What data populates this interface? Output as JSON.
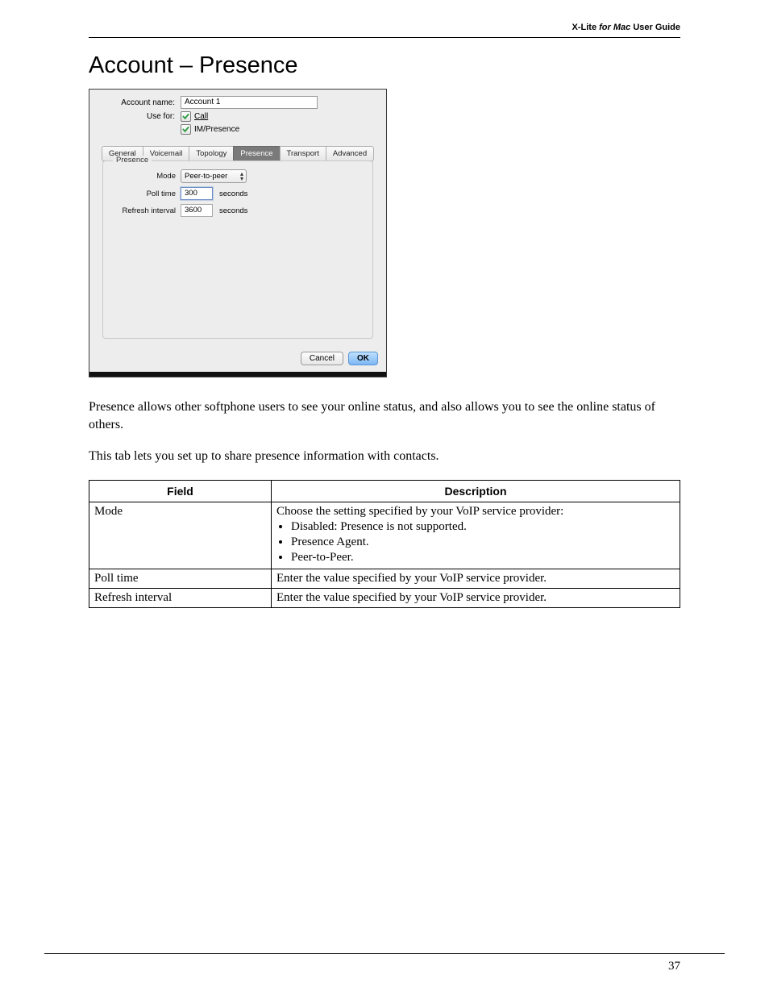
{
  "header": {
    "product": "X-Lite",
    "platform_italic": "for Mac",
    "suffix": "User Guide"
  },
  "title": "Account – Presence",
  "screenshot": {
    "account_name_label": "Account name:",
    "account_name_value": "Account 1",
    "use_for_label": "Use for:",
    "use_for_call": "Call",
    "use_for_im": "IM/Presence",
    "tabs": {
      "general": "General",
      "voicemail": "Voicemail",
      "topology": "Topology",
      "presence": "Presence",
      "transport": "Transport",
      "advanced": "Advanced"
    },
    "group_title": "Presence",
    "mode_label": "Mode",
    "mode_value": "Peer-to-peer",
    "poll_label": "Poll time",
    "poll_value": "300",
    "refresh_label": "Refresh interval",
    "refresh_value": "3600",
    "unit": "seconds",
    "cancel": "Cancel",
    "ok": "OK"
  },
  "paragraphs": {
    "p1": "Presence allows other softphone users to see your online status, and also allows you to see the online status of others.",
    "p2": "This tab lets you set up to share presence information with contacts."
  },
  "table": {
    "head_field": "Field",
    "head_desc": "Description",
    "mode_field": "Mode",
    "mode_intro": "Choose the setting specified by your VoIP service provider:",
    "mode_b1": "Disabled: Presence is not supported.",
    "mode_b2": "Presence Agent.",
    "mode_b3": "Peer-to-Peer.",
    "poll_field": "Poll time",
    "poll_desc": "Enter the value specified by your VoIP service provider.",
    "refresh_field": "Refresh interval",
    "refresh_desc": "Enter the value specified by your VoIP service provider."
  },
  "page_number": "37"
}
